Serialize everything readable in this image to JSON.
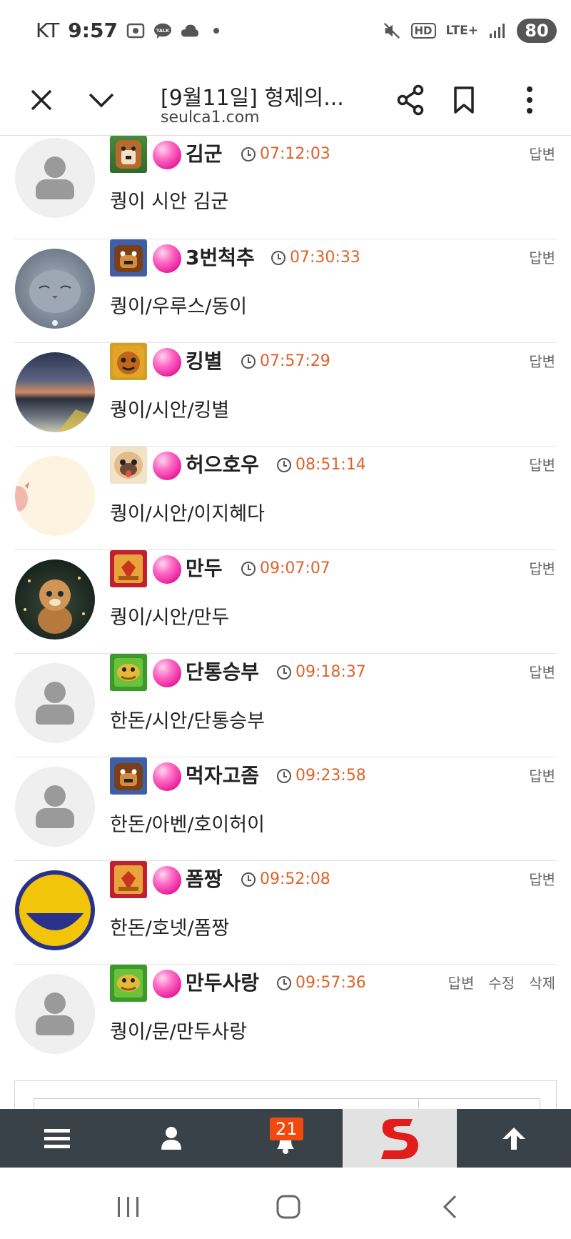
{
  "status_bar": {
    "carrier": "KT",
    "time": "9:57",
    "network": "LTE+",
    "hd": "HD",
    "battery": "80"
  },
  "browser": {
    "title": "[9월11일] 형제의...",
    "url": "seulca1.com"
  },
  "labels": {
    "reply": "답변",
    "edit": "수정",
    "delete": "삭제"
  },
  "comments": [
    {
      "nickname": "김군",
      "time": "07:12:03",
      "text": "퀑이 시안 김군"
    },
    {
      "nickname": "3번척추",
      "time": "07:30:33",
      "text": "퀑이/우루스/동이"
    },
    {
      "nickname": "킹별",
      "time": "07:57:29",
      "text": "퀑이/시안/킹별"
    },
    {
      "nickname": "허으호우",
      "time": "08:51:14",
      "text": "퀑이/시안/이지혜다"
    },
    {
      "nickname": "만두",
      "time": "09:07:07",
      "text": "퀑이/시안/만두"
    },
    {
      "nickname": "단통승부",
      "time": "09:18:37",
      "text": "한돈/시안/단통승부"
    },
    {
      "nickname": "먹자고좀",
      "time": "09:23:58",
      "text": "한돈/아벤/호이허이"
    },
    {
      "nickname": "폼짱",
      "time": "09:52:08",
      "text": "한돈/호넷/폼짱"
    },
    {
      "nickname": "만두사랑",
      "time": "09:57:36",
      "text": "퀑이/문/만두사랑"
    }
  ],
  "site_nav": {
    "notification_count": "21"
  },
  "colors": {
    "time_text": "#e0612a",
    "nav_bg": "#3a4249",
    "badge_bg": "#f04a0e"
  }
}
